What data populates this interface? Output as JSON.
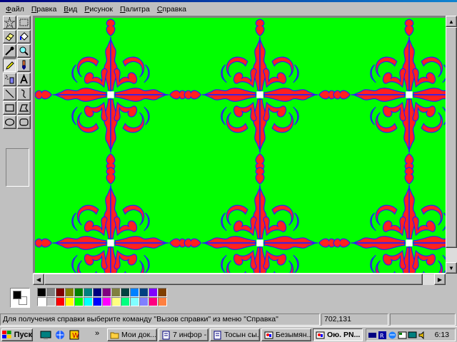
{
  "window": {
    "menu": [
      {
        "label": "Файл",
        "accel": "Ф",
        "rest": "айл"
      },
      {
        "label": "Правка",
        "accel": "П",
        "rest": "равка"
      },
      {
        "label": "Вид",
        "accel": "В",
        "rest": "ид"
      },
      {
        "label": "Рисунок",
        "accel": "Р",
        "rest": "исунок"
      },
      {
        "label": "Палитра",
        "accel": "П",
        "rest": "алитра"
      },
      {
        "label": "Справка",
        "accel": "С",
        "rest": "правка"
      }
    ]
  },
  "toolbox": {
    "tools": [
      {
        "name": "free-select",
        "icon": "star-select-icon"
      },
      {
        "name": "rect-select",
        "icon": "rect-select-icon"
      },
      {
        "name": "eraser",
        "icon": "eraser-icon"
      },
      {
        "name": "fill",
        "icon": "fill-bucket-icon"
      },
      {
        "name": "color-picker",
        "icon": "eyedropper-icon"
      },
      {
        "name": "magnifier",
        "icon": "magnifier-icon"
      },
      {
        "name": "pencil",
        "icon": "pencil-icon",
        "pressed": true
      },
      {
        "name": "brush",
        "icon": "brush-icon"
      },
      {
        "name": "airbrush",
        "icon": "airbrush-icon"
      },
      {
        "name": "text",
        "icon": "text-icon"
      },
      {
        "name": "line",
        "icon": "line-icon"
      },
      {
        "name": "curve",
        "icon": "curve-icon"
      },
      {
        "name": "rectangle",
        "icon": "rectangle-icon"
      },
      {
        "name": "polygon",
        "icon": "polygon-icon"
      },
      {
        "name": "ellipse",
        "icon": "ellipse-icon"
      },
      {
        "name": "rounded-rectangle",
        "icon": "rounded-rect-icon"
      }
    ]
  },
  "canvas": {
    "colors": {
      "background": "#00ff00",
      "ornament": "#ff2020",
      "outline": "#2020ff",
      "center": "#ffffff"
    }
  },
  "palette": {
    "foreground": "#000000",
    "background": "#ffffff",
    "colors": [
      "#000000",
      "#808080",
      "#800000",
      "#808000",
      "#008000",
      "#008080",
      "#000080",
      "#800080",
      "#808040",
      "#004040",
      "#0080ff",
      "#004080",
      "#8000ff",
      "#804000",
      "#ffffff",
      "#c0c0c0",
      "#ff0000",
      "#ffff00",
      "#00ff00",
      "#00ffff",
      "#0000ff",
      "#ff00ff",
      "#ffff80",
      "#00ff80",
      "#80ffff",
      "#8080ff",
      "#ff0080",
      "#ff8040"
    ]
  },
  "statusbar": {
    "help_text": "Для получения справки выберите команду \"Вызов справки\" из меню \"Справка\"",
    "coords": "702,131"
  },
  "taskbar": {
    "start_label": "Пуск",
    "chevron": "»",
    "tasks": [
      {
        "label": "Мои док...",
        "icon": "folder-icon"
      },
      {
        "label": "7 инфор - ...",
        "icon": "word-doc-icon"
      },
      {
        "label": "Тосын сы...",
        "icon": "word-doc-icon"
      },
      {
        "label": "Безымян...",
        "icon": "paint-icon"
      },
      {
        "label": "Ою. PN...",
        "icon": "paint-icon",
        "active": true
      }
    ],
    "clock": "6:13"
  }
}
